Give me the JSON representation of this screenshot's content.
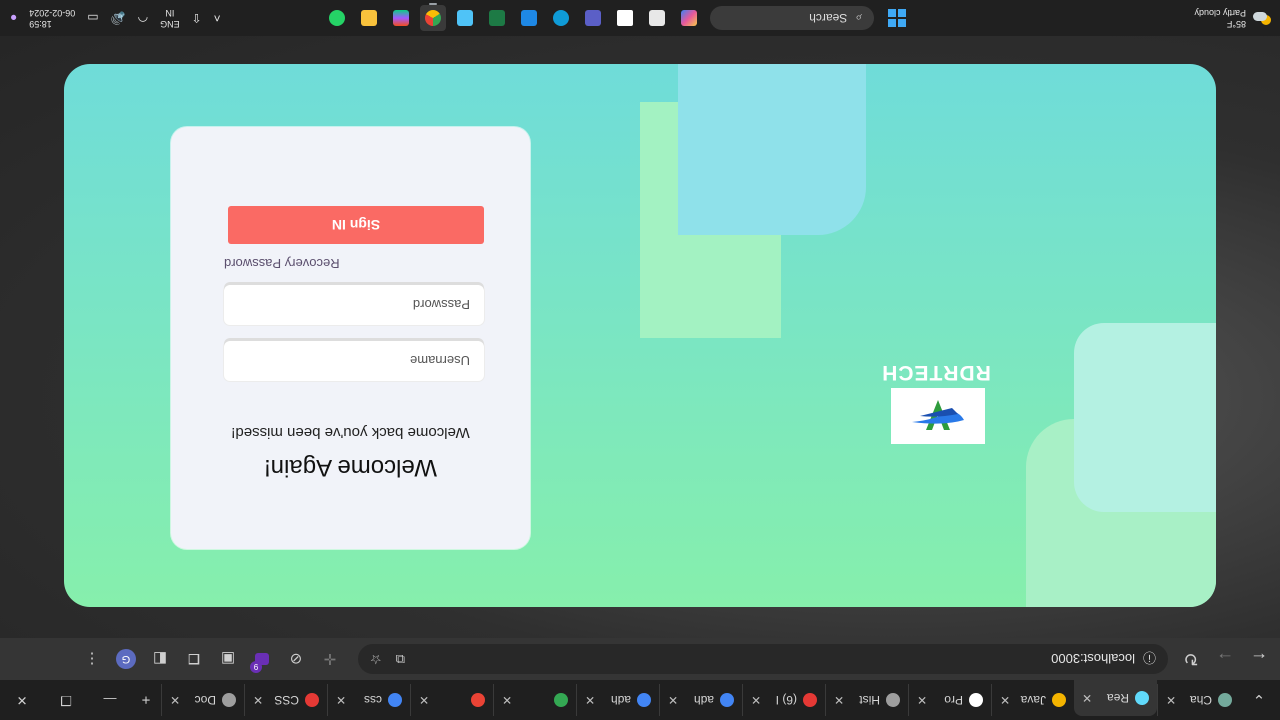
{
  "browser": {
    "tabs": [
      {
        "label": "Cha",
        "favicon_color": "#74aa9c",
        "active": false
      },
      {
        "label": "Rea",
        "favicon_color": "#61dafb",
        "active": true
      },
      {
        "label": "Java",
        "favicon_color": "#f4b400",
        "active": false
      },
      {
        "label": "Pro",
        "favicon_color": "#ffffff",
        "active": false
      },
      {
        "label": "Hist",
        "favicon_color": "#9e9e9e",
        "active": false
      },
      {
        "label": "(6) I",
        "favicon_color": "#e53935",
        "active": false
      },
      {
        "label": "adh",
        "favicon_color": "#4285f4",
        "active": false
      },
      {
        "label": "adh",
        "favicon_color": "#4285f4",
        "active": false
      },
      {
        "label": "",
        "favicon_color": "#34a853",
        "active": false
      },
      {
        "label": "",
        "favicon_color": "#ea4335",
        "active": false
      },
      {
        "label": "css",
        "favicon_color": "#4285f4",
        "active": false
      },
      {
        "label": "CSS",
        "favicon_color": "#e53935",
        "active": false
      },
      {
        "label": "Doc",
        "favicon_color": "#9e9e9e",
        "active": false
      }
    ],
    "new_tab_symbol": "+",
    "address": "localhost:3000",
    "extension_badge": "9",
    "profile_initial": "G"
  },
  "page": {
    "brand_name": "RDRTECH",
    "login": {
      "title": "Welcome Again!",
      "subtitle": "Welcome back you've been missed!",
      "username_placeholder": "Username",
      "password_placeholder": "Password",
      "recovery_link": "Recovery Password",
      "signin_label": "Sign IN"
    }
  },
  "taskbar": {
    "weather_temp": "85°F",
    "weather_desc": "Partly cloudy",
    "search_label": "Search",
    "language": "ENG",
    "region": "IN",
    "time": "18:59",
    "date": "06-02-2024"
  },
  "colors": {
    "card_top": "#86efac",
    "card_bottom": "#6fdcd9",
    "signin_button": "#fa6a64",
    "panel": "#f1f3f9"
  }
}
